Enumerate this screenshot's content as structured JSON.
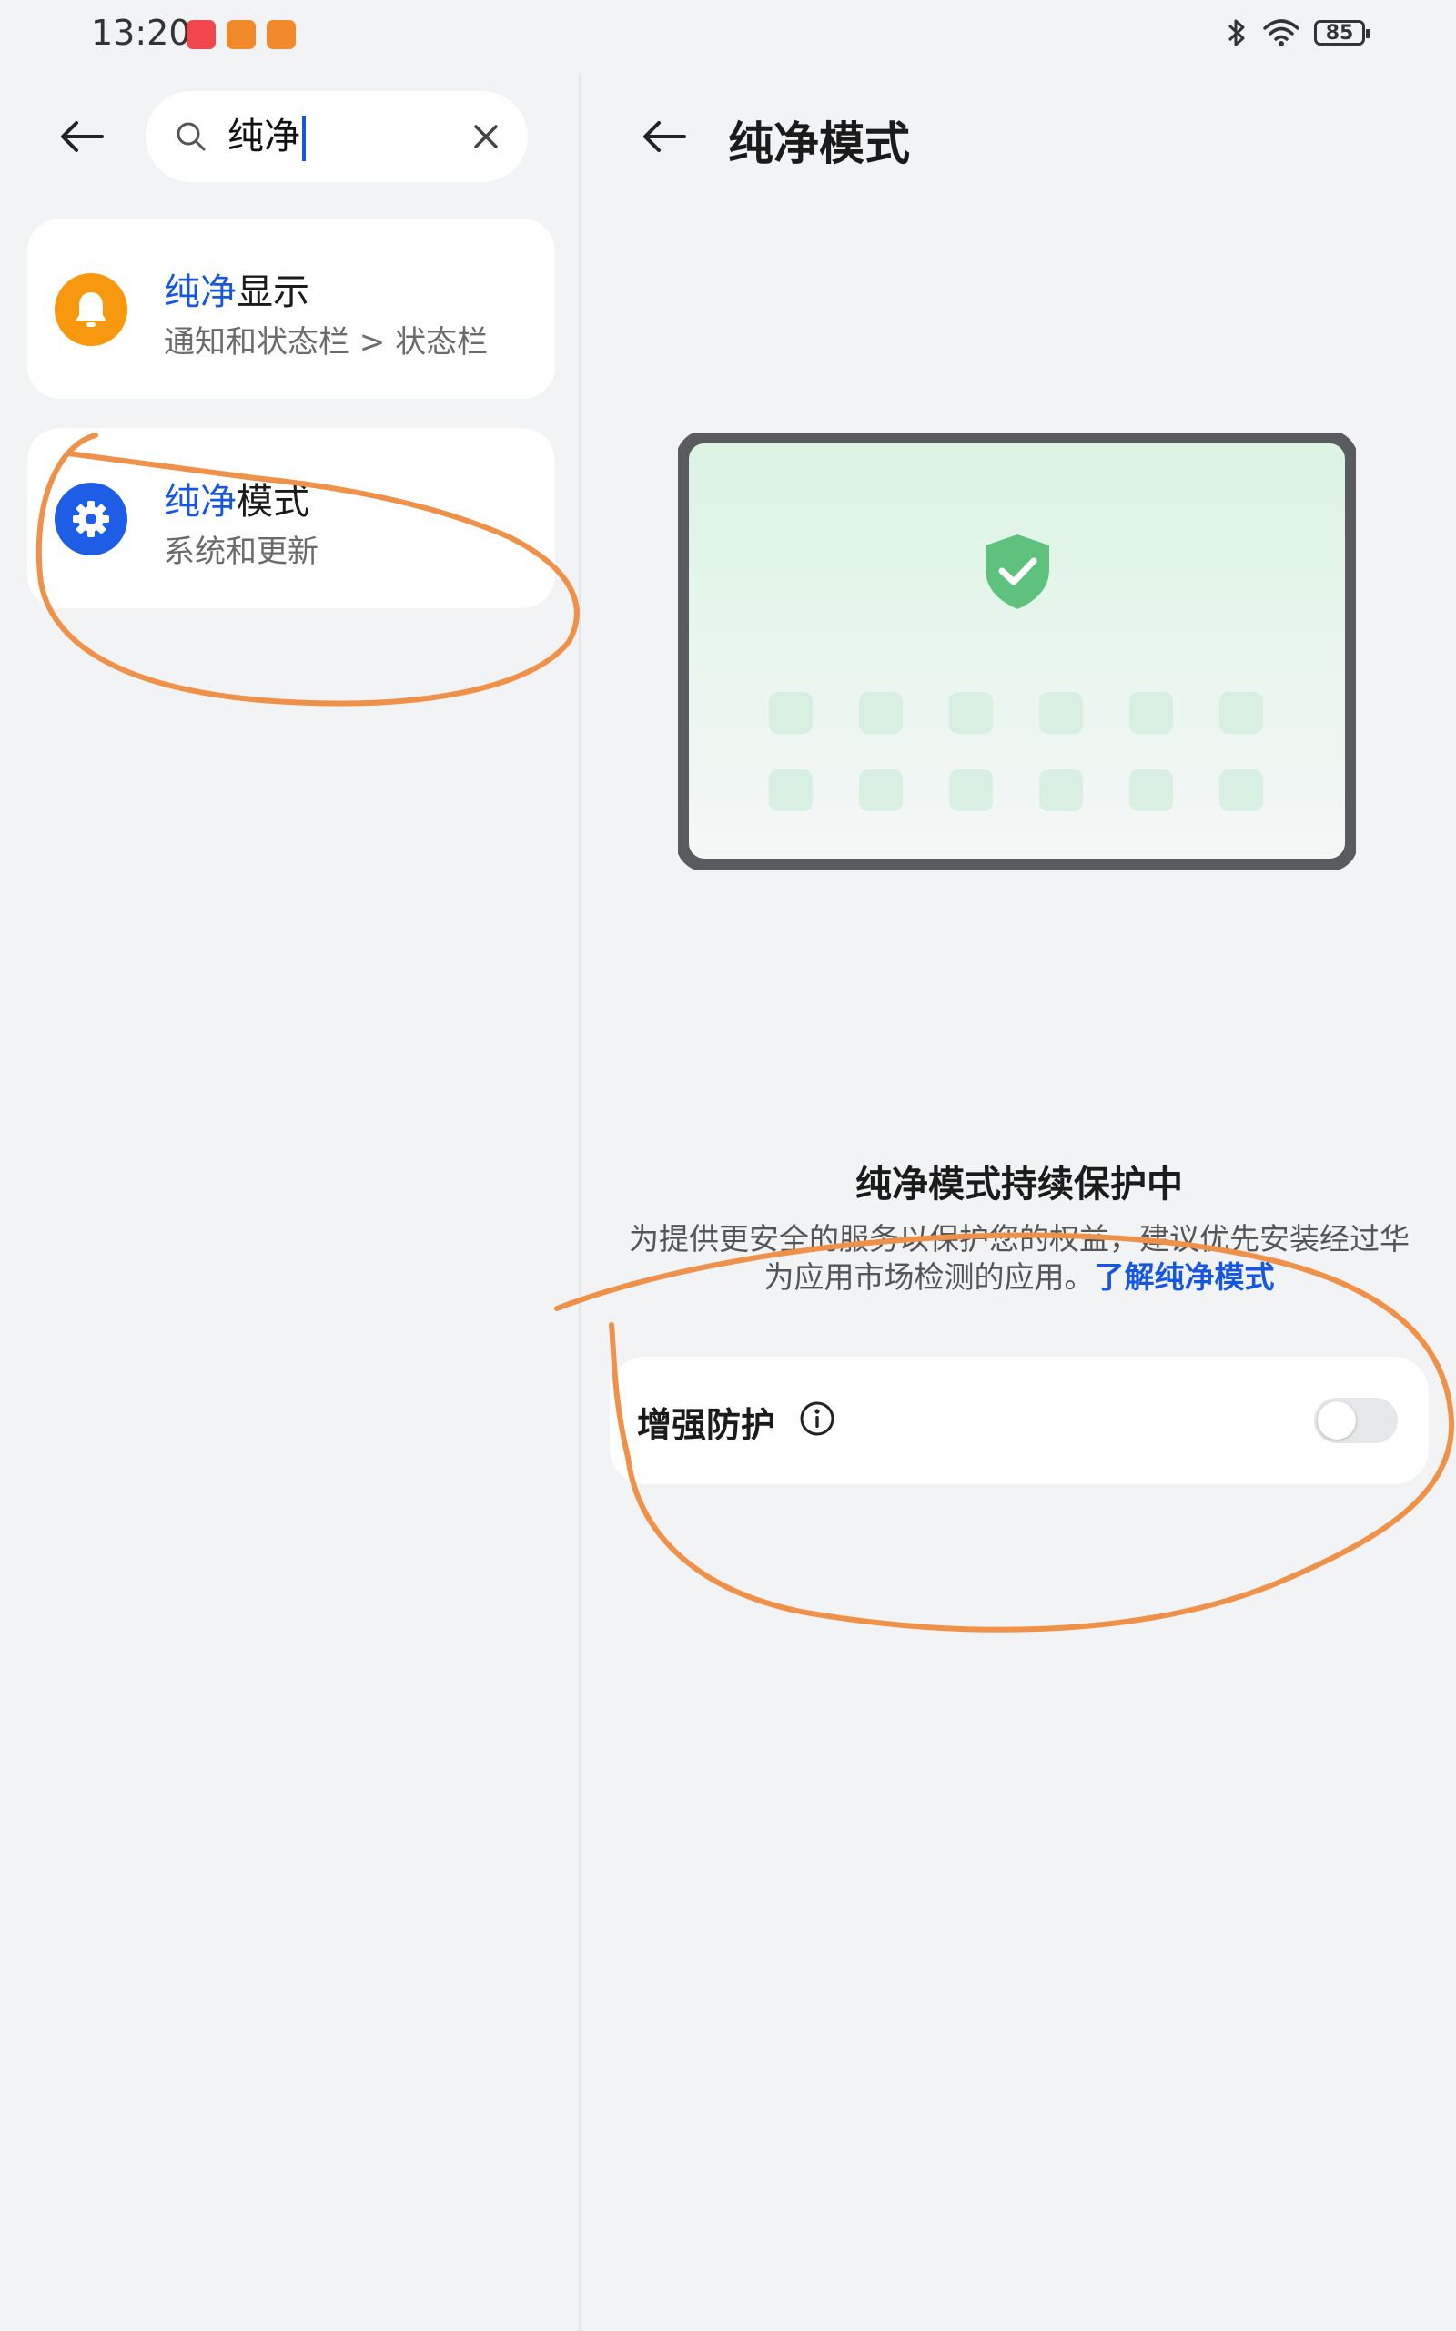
{
  "status_bar": {
    "time": "13:20",
    "battery": "85"
  },
  "search": {
    "query": "纯净"
  },
  "results": [
    {
      "title_highlight": "纯净",
      "title_rest": "显示",
      "path": "通知和状态栏 > 状态栏",
      "icon": "bell-icon"
    },
    {
      "title_highlight": "纯净",
      "title_rest": "模式",
      "path": "系统和更新",
      "icon": "gear-icon"
    }
  ],
  "detail": {
    "title": "纯净模式",
    "protect_title": "纯净模式持续保护中",
    "protect_desc": "为提供更安全的服务以保护您的权益，建议优先安装经过华为应用市场检测的应用。",
    "learn_more": "了解纯净模式",
    "enhance_label": "增强防护",
    "enhance_enabled": false
  },
  "colors": {
    "accent": "#1757e0",
    "annotation": "#f0914a",
    "bell_bg": "#f7980f",
    "gear_bg": "#1e5de6"
  }
}
